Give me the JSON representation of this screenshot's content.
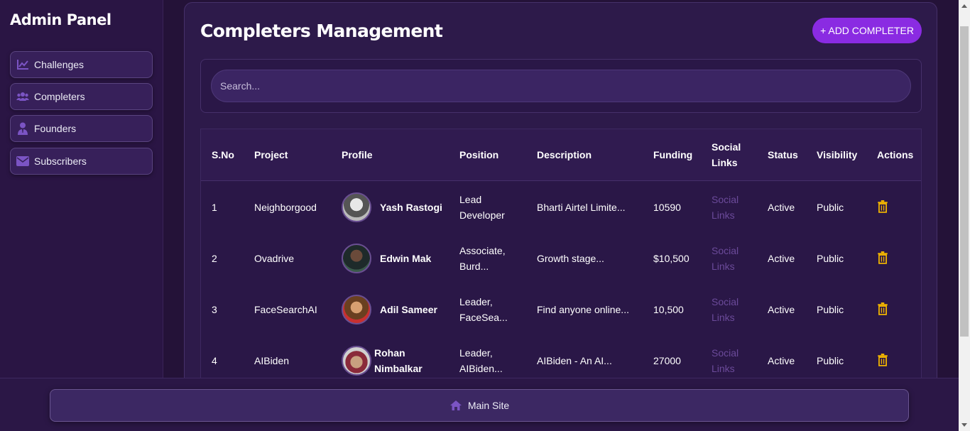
{
  "sidebar": {
    "title": "Admin Panel",
    "items": [
      {
        "label": "Challenges",
        "icon": "chart-line-icon"
      },
      {
        "label": "Completers",
        "icon": "users-icon"
      },
      {
        "label": "Founders",
        "icon": "user-tie-icon"
      },
      {
        "label": "Subscribers",
        "icon": "envelope-icon"
      }
    ]
  },
  "header": {
    "title": "Completers Management",
    "add_button_label": "+ ADD COMPLETER"
  },
  "search": {
    "placeholder": "Search...",
    "value": ""
  },
  "table": {
    "columns": [
      "S.No",
      "Project",
      "Profile",
      "Position",
      "Description",
      "Funding",
      "Social",
      "Links",
      "Status",
      "Visibility",
      "Actions"
    ],
    "rows": [
      {
        "sno": "1",
        "project": "Neighborgood",
        "name_line1": "Yash Rastogi",
        "name_line2": "",
        "position_line1": "Lead",
        "position_line2": "Developer",
        "description": "Bharti Airtel Limite...",
        "funding": "10590",
        "social_line1": "Social",
        "social_line2": "Links",
        "status": "Active",
        "visibility": "Public"
      },
      {
        "sno": "2",
        "project": "Ovadrive",
        "name_line1": "Edwin Mak",
        "name_line2": "",
        "position_line1": "Associate,",
        "position_line2": "Burd...",
        "description": "Growth stage...",
        "funding": "$10,500",
        "social_line1": "Social",
        "social_line2": "Links",
        "status": "Active",
        "visibility": "Public"
      },
      {
        "sno": "3",
        "project": "FaceSearchAI",
        "name_line1": "Adil Sameer",
        "name_line2": "",
        "position_line1": "Leader,",
        "position_line2": "FaceSea...",
        "description": "Find anyone online...",
        "funding": "10,500",
        "social_line1": "Social",
        "social_line2": "Links",
        "status": "Active",
        "visibility": "Public"
      },
      {
        "sno": "4",
        "project": "AIBiden",
        "name_line1": "Rohan",
        "name_line2": "Nimbalkar",
        "position_line1": "Leader,",
        "position_line2": "AIBiden...",
        "description": "AIBiden - An AI...",
        "funding": "27000",
        "social_line1": "Social",
        "social_line2": "Links",
        "status": "Active",
        "visibility": "Public"
      }
    ]
  },
  "footer": {
    "main_site_label": "Main Site",
    "icon": "home-icon"
  },
  "colors": {
    "background": "#241238",
    "accent": "#8a2be2",
    "trash": "#f0b400",
    "link": "#6b4a9a"
  }
}
